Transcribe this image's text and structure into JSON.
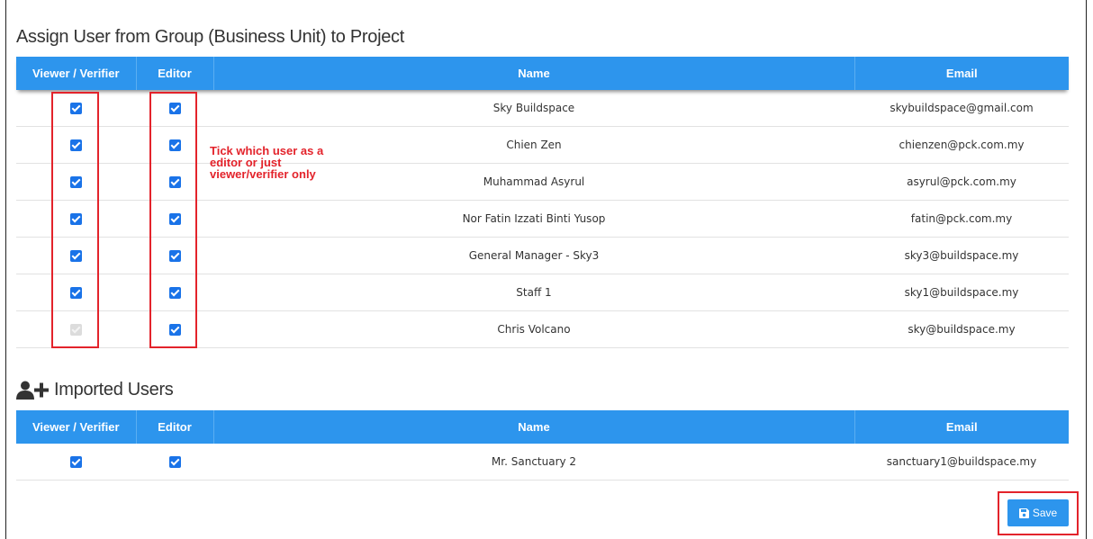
{
  "section1": {
    "title": "Assign User from Group (Business Unit) to Project",
    "columns": [
      "Viewer / Verifier",
      "Editor",
      "Name",
      "Email"
    ],
    "rows": [
      {
        "name": "Sky Buildspace",
        "email": "skybuildspace@gmail.com",
        "viewer": true,
        "editor": true,
        "viewer_disabled": false
      },
      {
        "name": "Chien Zen",
        "email": "chienzen@pck.com.my",
        "viewer": true,
        "editor": true,
        "viewer_disabled": false
      },
      {
        "name": "Muhammad Asyrul",
        "email": "asyrul@pck.com.my",
        "viewer": true,
        "editor": true,
        "viewer_disabled": false
      },
      {
        "name": "Nor Fatin Izzati Binti Yusop",
        "email": "fatin@pck.com.my",
        "viewer": true,
        "editor": true,
        "viewer_disabled": false
      },
      {
        "name": "General Manager - Sky3",
        "email": "sky3@buildspace.my",
        "viewer": true,
        "editor": true,
        "viewer_disabled": false
      },
      {
        "name": "Staff 1",
        "email": "sky1@buildspace.my",
        "viewer": true,
        "editor": true,
        "viewer_disabled": false
      },
      {
        "name": "Chris Volcano",
        "email": "sky@buildspace.my",
        "viewer": true,
        "editor": true,
        "viewer_disabled": true
      }
    ]
  },
  "annotation": "Tick which user as a editor or just viewer/verifier only",
  "section2": {
    "title": "Imported Users",
    "icon": "user-plus-icon",
    "columns": [
      "Viewer / Verifier",
      "Editor",
      "Name",
      "Email"
    ],
    "rows": [
      {
        "name": "Mr. Sanctuary 2",
        "email": "sanctuary1@buildspace.my",
        "viewer": true,
        "editor": true,
        "viewer_disabled": false
      }
    ]
  },
  "save_button": {
    "label": "Save",
    "icon": "floppy-disk-icon"
  },
  "colors": {
    "header": "#2d95ed",
    "annotation": "#e3232b",
    "checkbox": "#1a73e8"
  }
}
